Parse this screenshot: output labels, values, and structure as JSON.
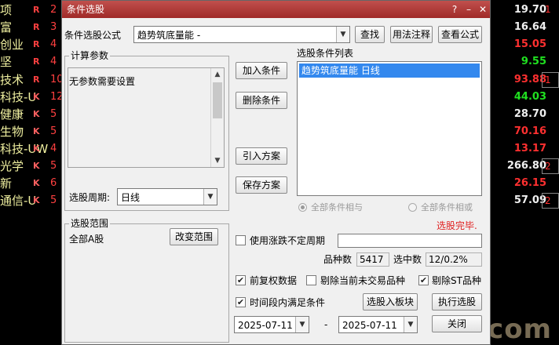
{
  "background": {
    "left_rows": [
      {
        "name": "项",
        "flag": "R",
        "num": "2"
      },
      {
        "name": "富",
        "flag": "R",
        "num": "3"
      },
      {
        "name": "创业",
        "flag": "R",
        "num": "4"
      },
      {
        "name": "坚",
        "flag": "R",
        "num": "4"
      },
      {
        "name": "技术",
        "flag": "R",
        "num": "10"
      },
      {
        "name": "科技-U",
        "flag": "K",
        "num": "12"
      },
      {
        "name": "健康",
        "flag": "K",
        "num": "5"
      },
      {
        "name": "生物",
        "flag": "K",
        "num": "5"
      },
      {
        "name": "科技-UW",
        "flag": "K",
        "num": "4"
      },
      {
        "name": "光学",
        "flag": "K",
        "num": "5"
      },
      {
        "name": "新",
        "flag": "K",
        "num": "6"
      },
      {
        "name": "通信-U",
        "flag": "K",
        "num": "5"
      }
    ],
    "right_prices": [
      {
        "value": "19.70",
        "color": "white"
      },
      {
        "value": "16.64",
        "color": "white"
      },
      {
        "value": "15.05",
        "color": "red"
      },
      {
        "value": "9.55",
        "color": "green"
      },
      {
        "value": "93.88",
        "color": "red"
      },
      {
        "value": "44.03",
        "color": "green"
      },
      {
        "value": "28.70",
        "color": "white"
      },
      {
        "value": "70.16",
        "color": "red"
      },
      {
        "value": "13.17",
        "color": "red"
      },
      {
        "value": "266.80",
        "color": "white"
      },
      {
        "value": "26.15",
        "color": "red"
      },
      {
        "value": "57.09",
        "color": "white"
      }
    ],
    "right_edge_nums": [
      "1",
      "",
      "",
      "",
      "1",
      "",
      "",
      "",
      "",
      "2",
      "",
      "2"
    ],
    "watermark": "aiguqi.com"
  },
  "dialog": {
    "title": "条件选股",
    "title_buttons": [
      "?",
      "–",
      "✕"
    ],
    "formula_label": "条件选股公式",
    "formula_value": "趋势筑底量能  -",
    "find_button": "查找",
    "usage_button": "用法注释",
    "view_formula_button": "查看公式",
    "calc_params_title": "计算参数",
    "no_params_text": "无参数需要设置",
    "period_label": "选股周期:",
    "period_value": "日线",
    "add_condition_button": "加入条件",
    "delete_condition_button": "删除条件",
    "import_plan_button": "引入方案",
    "save_plan_button": "保存方案",
    "condition_list_title": "选股条件列表",
    "condition_items": [
      "趋势筑底量能  日线"
    ],
    "radio_and": "全部条件相与",
    "radio_or": "全部条件相或",
    "status_text": "选股完毕.",
    "range_title": "选股范围",
    "range_value": "全部A股",
    "change_range_button": "改变范围",
    "use_variable_period": "使用涨跌不定周期",
    "variety_count_label": "品种数",
    "variety_count_value": "5417",
    "selected_label": "选中数",
    "selected_value": "12/0.2%",
    "forward_adjust": "前复权数据",
    "exclude_non_trading": "剔除当前未交易品种",
    "exclude_st": "剔除ST品种",
    "time_period_condition": "时间段内满足条件",
    "add_to_block_button": "选股入板块",
    "execute_button": "执行选股",
    "start_date": "2025-07-11",
    "date_separator": "-",
    "end_date": "2025-07-11",
    "close_button": "关闭",
    "icons": {
      "dropdown": "chevron-down-icon",
      "check": "check-icon",
      "scroll_up": "scroll-up-icon",
      "scroll_down": "scroll-down-icon"
    },
    "colors": {
      "title_bar": "#b03a38",
      "selection": "#3388ee",
      "status": "#e02020"
    }
  }
}
